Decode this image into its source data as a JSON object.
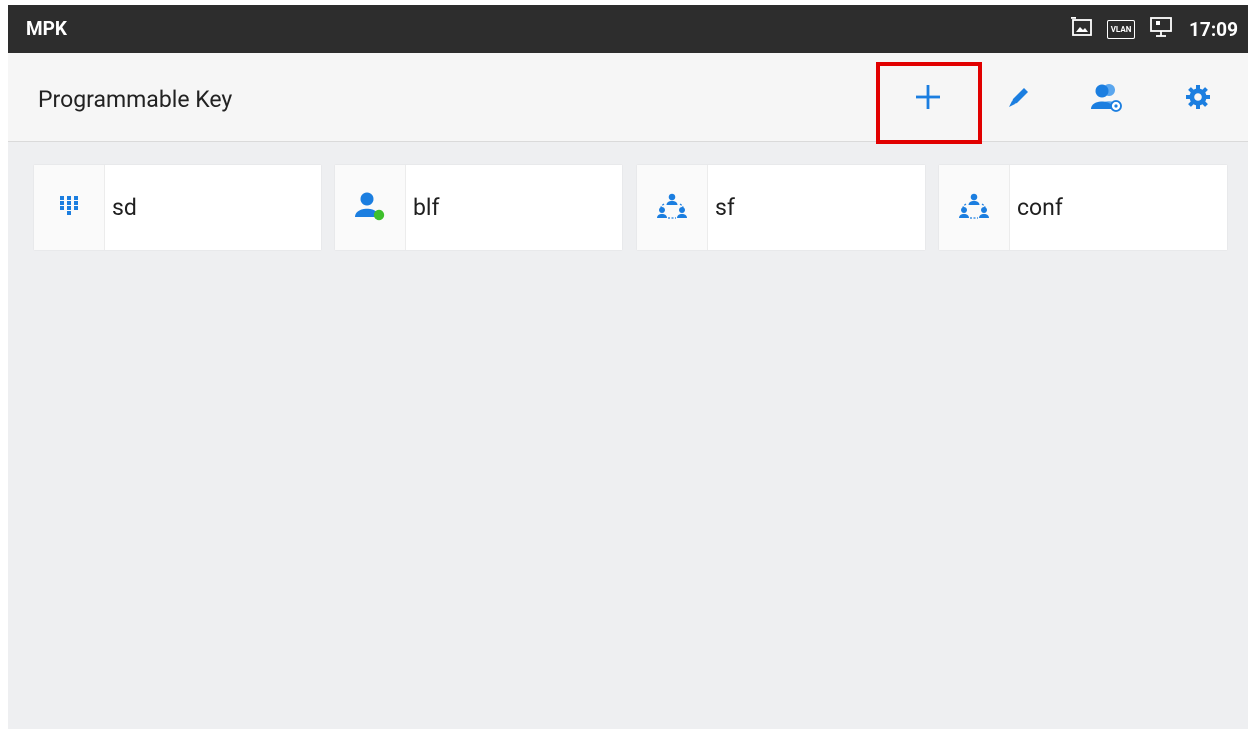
{
  "statusbar": {
    "app_name": "MPK",
    "clock": "17:09",
    "icons": [
      "screenshot-icon",
      "vlan-icon",
      "network-icon"
    ],
    "vlan_text": "VLAN"
  },
  "toolbar": {
    "title": "Programmable Key",
    "actions": [
      "add-icon",
      "edit-icon",
      "contacts-icon",
      "settings-icon"
    ]
  },
  "keys": [
    {
      "label": "sd",
      "icon": "dialpad-icon"
    },
    {
      "label": "blf",
      "icon": "blf-contact-icon"
    },
    {
      "label": "sf",
      "icon": "group-icon"
    },
    {
      "label": "conf",
      "icon": "group-icon"
    }
  ],
  "colors": {
    "accent": "#1b7ee0",
    "statusbar": "#2d2d2d",
    "highlight": "#e10000",
    "presence": "#3ec02c"
  }
}
